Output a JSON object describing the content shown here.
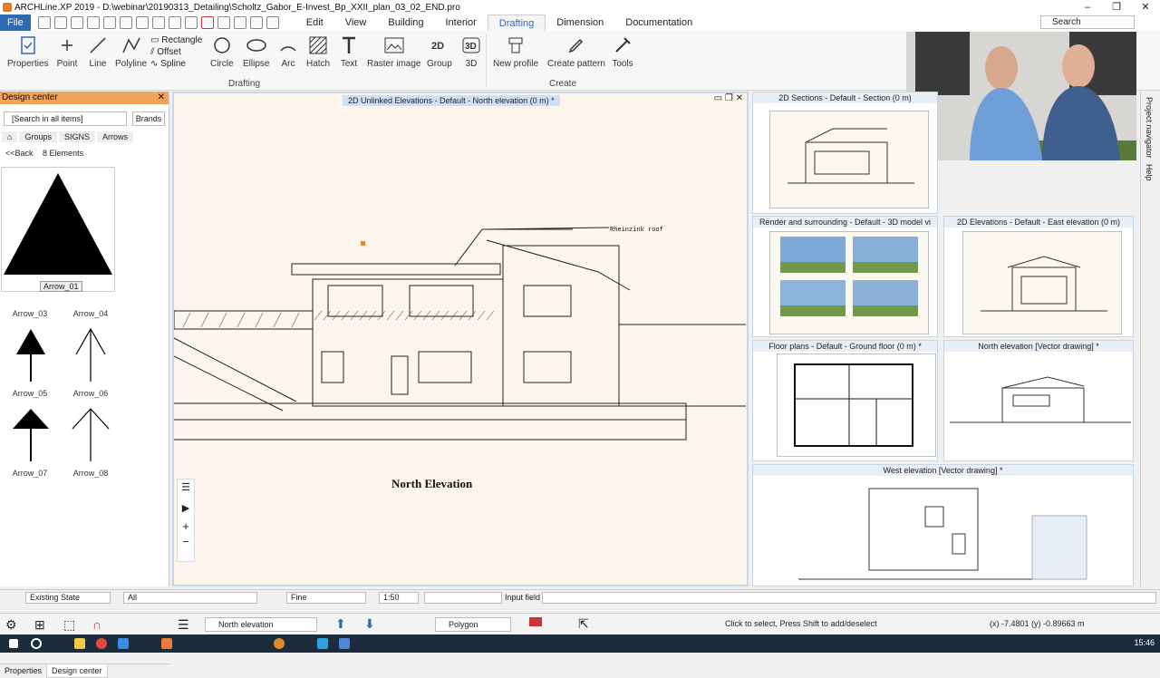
{
  "window": {
    "title": "ARCHLine.XP 2019 - D:\\webinar\\20190313_Detailing\\Scholtz_Gabor_E-Invest_Bp_XXII_plan_03_02_END.pro",
    "minimize": "–",
    "maximize": "❐",
    "close": "✕"
  },
  "menu": {
    "file": "File",
    "tabs": [
      "Edit",
      "View",
      "Building",
      "Interior",
      "Drafting",
      "Dimension",
      "Documentation"
    ],
    "search_placeholder": "Search"
  },
  "ribbon": {
    "buttons": [
      "Properties",
      "Point",
      "Line",
      "Polyline",
      "Circle",
      "Ellipse",
      "Arc",
      "Hatch",
      "Text",
      "Raster image",
      "Group",
      "3D",
      "New profile",
      "Create pattern",
      "Tools"
    ],
    "options": [
      "Rectangle",
      "Offset",
      "Spline"
    ],
    "groups": [
      "Drafting",
      "Create"
    ]
  },
  "design_center": {
    "title": "Design center",
    "search": "[Search in all items]",
    "brands": "Brands",
    "crumbs": [
      "Groups",
      "SIGNS",
      "Arrows"
    ],
    "back": "<<Back",
    "count": "8 Elements",
    "selected": "Arrow_01",
    "items": [
      "Arrow_03",
      "Arrow_04",
      "Arrow_05",
      "Arrow_06",
      "Arrow_07",
      "Arrow_08"
    ],
    "tabs": [
      "Properties",
      "Design center"
    ]
  },
  "main_view": {
    "title": "2D Unlinked Elevations - Default - North elevation (0 m) *",
    "label": "North Elevation",
    "annotation": "Rheinzink roof"
  },
  "viewports": [
    "2D Sections - Default - Section (0 m)",
    "Render and surrounding - Default - 3D model vi",
    "2D Elevations - Default - East elevation (0 m)",
    "Floor plans - Default - Ground floor (0 m) *",
    "North elevation [Vector drawing] *",
    "West elevation [Vector drawing] *"
  ],
  "side_tabs": [
    "Project navigator",
    "Help"
  ],
  "status": {
    "layer": "Existing State",
    "filter": "All",
    "line": "Fine",
    "scale": "1:50",
    "input_label": "Input field"
  },
  "toolbar": {
    "view_name": "North elevation",
    "polygon": "Polygon",
    "hint": "Click to select, Press Shift to add/deselect",
    "coords": "(x) -7.4801  (y) -0.89663 m"
  },
  "taskbar": {
    "clock": "15:46"
  },
  "colors": {
    "accent": "#2f6bb3",
    "panel_header": "#f0a35a",
    "canvas": "#fbf5eb"
  }
}
